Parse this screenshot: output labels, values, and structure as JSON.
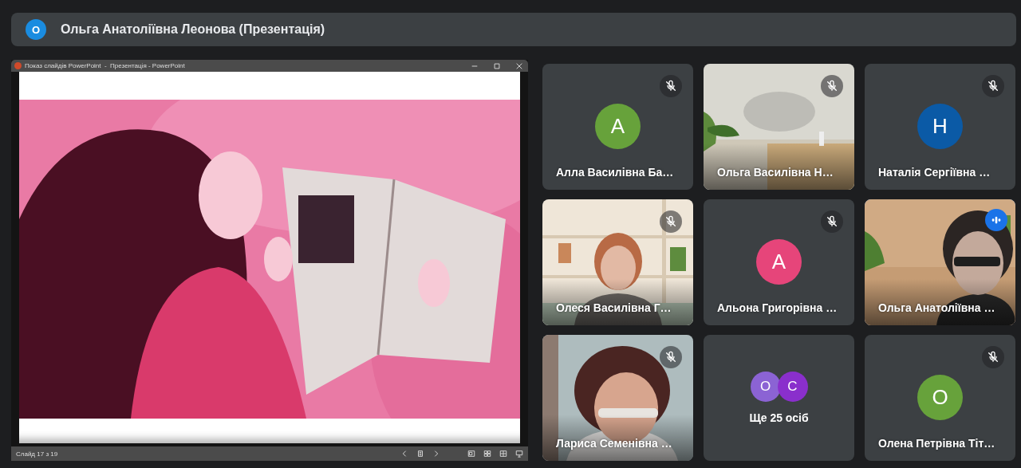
{
  "meeting_header": {
    "presenter_initial": "О",
    "title": "Ольга Анатоліївна Леонова (Презентація)"
  },
  "presentation_window": {
    "title": "Показ слайдів PowerPoint  -  Презентація - PowerPoint",
    "status": "Слайд 17 з 19"
  },
  "tiles": [
    {
      "kind": "avatar",
      "name": "Алла Василівна Ба…",
      "initial": "А",
      "color": "#67a23b",
      "muted": true,
      "speaking": false
    },
    {
      "kind": "video",
      "name": "Ольга Василівна Н…",
      "muted": true,
      "speaking": false
    },
    {
      "kind": "avatar",
      "name": "Наталія Сергіївна …",
      "initial": "Н",
      "color": "#0b5aa6",
      "muted": true,
      "speaking": false
    },
    {
      "kind": "video",
      "name": "Олеся Василівна Г…",
      "muted": true,
      "speaking": false
    },
    {
      "kind": "avatar",
      "name": "Альона Григорівна …",
      "initial": "А",
      "color": "#e6457a",
      "muted": true,
      "speaking": false
    },
    {
      "kind": "video",
      "name": "Ольга Анатоліївна …",
      "muted": false,
      "speaking": true
    },
    {
      "kind": "video",
      "name": "Лариса Семенівна …",
      "muted": true,
      "speaking": false
    },
    {
      "kind": "more",
      "label": "Ще 25 осіб",
      "avatars": [
        {
          "initial": "О",
          "color": "#8b63d4"
        },
        {
          "initial": "С",
          "color": "#8a2fcc"
        }
      ]
    },
    {
      "kind": "avatar",
      "name": "Олена Петрівна Тіт…",
      "initial": "О",
      "color": "#67a23b",
      "muted": true,
      "speaking": false
    }
  ]
}
